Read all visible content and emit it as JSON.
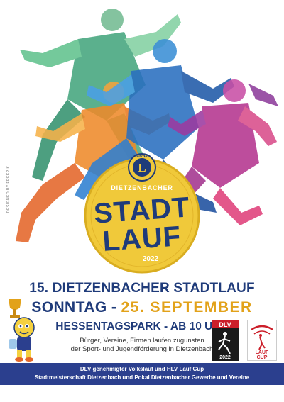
{
  "badge": {
    "club_text": "LIONS",
    "club_sub": "CLUBS INTERNATIONAL",
    "arc_text": "DIETZENBACHER",
    "title_line1": "STADT",
    "title_line2": "LAUF",
    "year": "2022"
  },
  "credit": "DESIGNED BY FREEPIK",
  "headline": {
    "line1": "15. DIETZENBACHER STADTLAUF",
    "day": "SONNTAG",
    "separator": " - ",
    "date": "25. SEPTEMBER",
    "venue": "HESSENTAGSPARK - AB 10 UHR"
  },
  "subtext": {
    "line1": "Bürger, Vereine, Firmen laufen zugunsten",
    "line2": "der Sport- und Jugendförderung in Dietzenbach"
  },
  "footer": {
    "line1": "DLV genehmigter Volkslauf und HLV Lauf Cup",
    "line2": "Stadtmeisterschaft Dietzenbach und Pokal Dietzenbacher Gewerbe und Vereine"
  },
  "logos": {
    "dlv_text": "DLV",
    "dlv_year": "2022",
    "cup_line1": "LAUF",
    "cup_line2": "CUP"
  },
  "colors": {
    "navy": "#1f3b7a",
    "gold": "#e2a21a",
    "band": "#2b3f8e",
    "badge_gold": "#f0c93a"
  }
}
